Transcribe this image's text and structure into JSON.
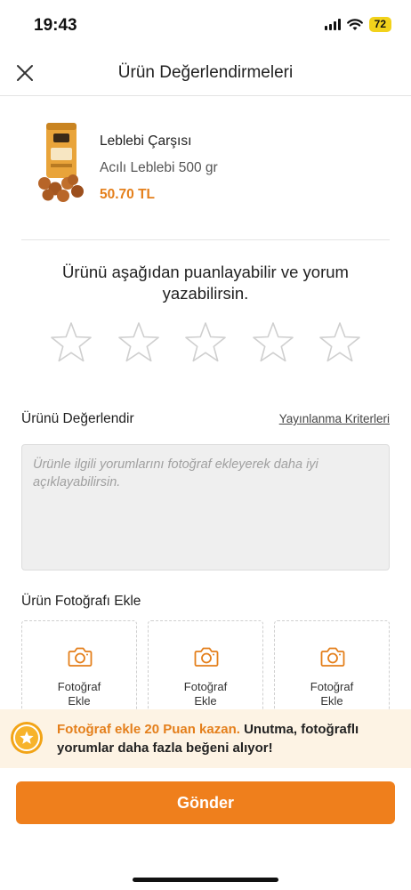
{
  "status_bar": {
    "time": "19:43",
    "battery": "72"
  },
  "header": {
    "title": "Ürün Değerlendirmeleri",
    "close_icon": "close-icon"
  },
  "product": {
    "brand": "Leblebi Çarşısı",
    "name": "Acılı Leblebi 500 gr",
    "price": "50.70 TL",
    "image_icon": "product-image"
  },
  "rating": {
    "prompt": "Ürünü aşağıdan puanlayabilir ve yorum yazabilirsin.",
    "stars_total": 5,
    "stars_selected": 0
  },
  "review": {
    "label": "Ürünü Değerlendir",
    "criteria_link": "Yayınlanma Kriterleri",
    "placeholder": "Ürünle ilgili yorumlarını fotoğraf ekleyerek daha iyi açıklayabilirsin.",
    "value": ""
  },
  "photos": {
    "label": "Ürün Fotoğrafı Ekle",
    "slots": [
      {
        "line1": "Fotoğraf",
        "line2": "Ekle"
      },
      {
        "line1": "Fotoğraf",
        "line2": "Ekle"
      },
      {
        "line1": "Fotoğraf",
        "line2": "Ekle"
      }
    ]
  },
  "banner": {
    "highlight": "Fotoğraf ekle 20 Puan kazan.",
    "text": " Unutma, fotoğraflı yorumlar daha fazla beğeni alıyor!"
  },
  "submit": {
    "label": "Gönder"
  },
  "colors": {
    "accent": "#ef7f1c",
    "price": "#e47f1b",
    "banner_bg": "#fdf3e4",
    "badge": "#f2a417"
  }
}
